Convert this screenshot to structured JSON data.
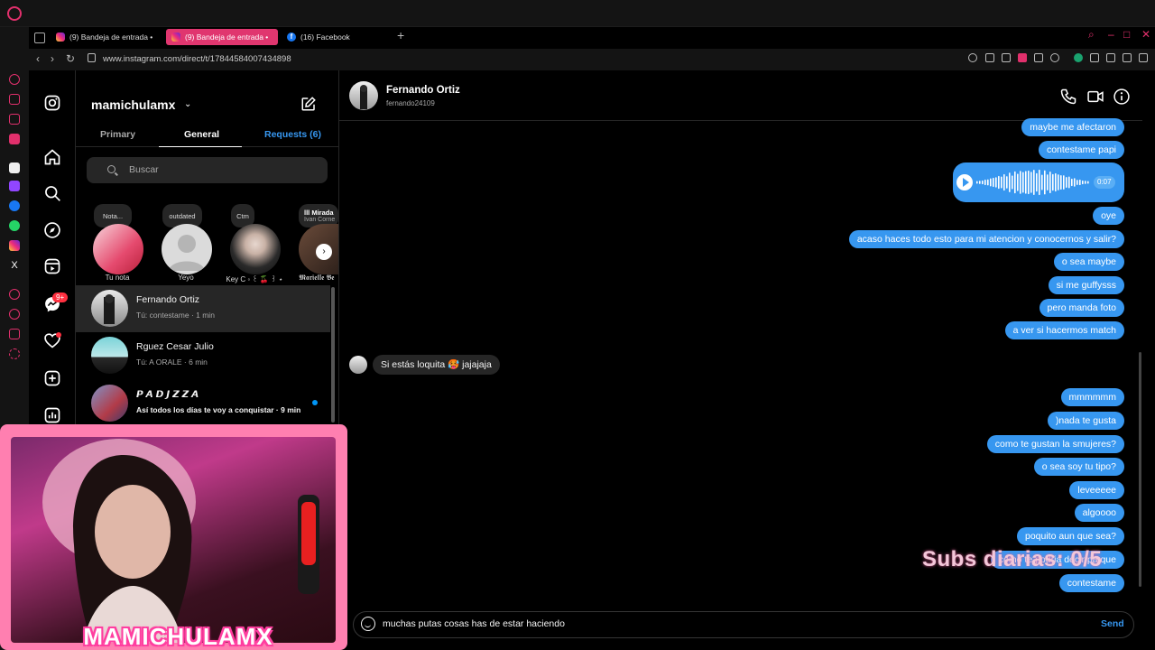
{
  "browser": {
    "tabs": [
      {
        "label": "(9) Bandeja de entrada •",
        "favicon": "instagram-icon",
        "active": false
      },
      {
        "label": "(9) Bandeja de entrada •",
        "favicon": "instagram-icon",
        "active": true
      },
      {
        "label": "(16) Facebook",
        "favicon": "facebook-icon",
        "active": false
      }
    ],
    "new_tab": "+",
    "url": "www.instagram.com/direct/t/17844584007434898",
    "accent": "#e0366f"
  },
  "inbox": {
    "username": "mamichulamx",
    "tabs": [
      {
        "label": "Primary"
      },
      {
        "label": "General"
      },
      {
        "label": "Requests (6)"
      }
    ],
    "search_placeholder": "Buscar",
    "notes": [
      {
        "bubble": "Nota...",
        "label": "Tu nota"
      },
      {
        "bubble": "outdated",
        "label": "Yeyo"
      },
      {
        "bubble": "Ctm",
        "label": "Key C ◦ ꒰ 🍒 ꒱ ⋆"
      },
      {
        "bubble": "lll Mirada",
        "bubble_sub": "Ivan Corne",
        "label": "𝕸𝖆𝖗𝖎𝖊𝖑𝖑𝖊 𝕭𝖊"
      }
    ],
    "threads": [
      {
        "name": "Fernando Ortiz",
        "preview": "Tú: contestame · 1 min",
        "unread": false
      },
      {
        "name": "Rguez Cesar Julio",
        "preview": "Tú: A ORALE · 6 min",
        "unread": false
      },
      {
        "name": "𝙋 𝘼 𝘿 𝙅 𝙕 𝙕 𝘼",
        "preview": "Así todos los días te voy a conquistar · 9 min",
        "unread": true
      }
    ]
  },
  "nav": {
    "notification_badge": "9+"
  },
  "overlay": {
    "streamer_name": "MAMICHULAMX",
    "subs_text": "Subs diarias: 0/5"
  },
  "chat": {
    "contact_name": "Fernando Ortiz",
    "contact_handle": "fernando24109",
    "voice_duration": "0:07",
    "messages_out_top": [
      "maybe me afectaron",
      "contestame papi"
    ],
    "messages_out_mid": [
      "oye",
      "acaso haces todo esto para mi atencion y conocernos y salir?",
      "o sea maybe",
      "si me guffysss",
      "pero manda foto",
      "a ver si hacermos match"
    ],
    "message_in": "Si estás loquita 🥵 jajajaja",
    "messages_out_bottom": [
      "mmmmmm",
      ")nada te gusta",
      "como te gustan la smujeres?",
      "o sea soy tu tipo?",
      "leveeeee",
      "algoooo",
      "poquito aun que sea?",
      "como te podria decir pa que",
      "contestame"
    ],
    "composer_text": "muchas putas cosas has de estar haciendo",
    "send_label": "Send"
  }
}
